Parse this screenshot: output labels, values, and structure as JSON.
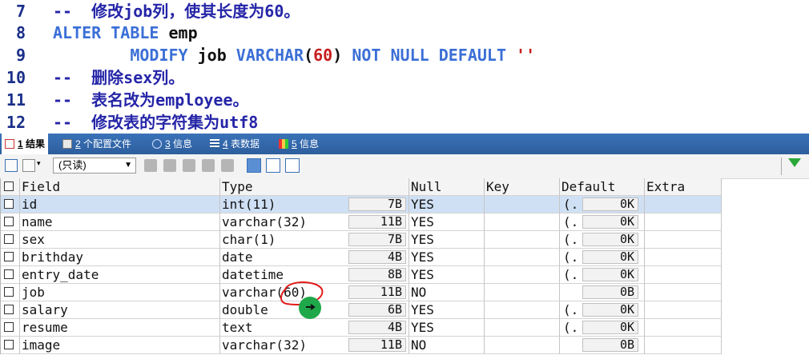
{
  "editor": {
    "lines": [
      {
        "num": "7",
        "parts": [
          {
            "cls": "cm",
            "t": "--  修改job列，使其长度为60。"
          }
        ]
      },
      {
        "num": "8",
        "parts": [
          {
            "cls": "kw",
            "t": "ALTER TABLE "
          },
          {
            "cls": "id",
            "t": "emp"
          }
        ]
      },
      {
        "num": "9",
        "parts": [
          {
            "cls": "kw",
            "t": "        MODIFY "
          },
          {
            "cls": "id",
            "t": "job "
          },
          {
            "cls": "kw",
            "t": "VARCHAR"
          },
          {
            "cls": "punc",
            "t": "("
          },
          {
            "cls": "num",
            "t": "60"
          },
          {
            "cls": "punc",
            "t": ") "
          },
          {
            "cls": "kw",
            "t": "NOT NULL DEFAULT "
          },
          {
            "cls": "str",
            "t": "''"
          }
        ]
      },
      {
        "num": "10",
        "parts": [
          {
            "cls": "cm",
            "t": "--  删除sex列。"
          }
        ]
      },
      {
        "num": "11",
        "parts": [
          {
            "cls": "cm",
            "t": "--  表名改为employee。"
          }
        ]
      },
      {
        "num": "12",
        "parts": [
          {
            "cls": "cm",
            "t": "--  修改表的字符集为utf8"
          }
        ]
      }
    ]
  },
  "tabs": [
    {
      "num": "1",
      "label": "结果"
    },
    {
      "num": "2",
      "label": "个配置文件"
    },
    {
      "num": "3",
      "label": "信息"
    },
    {
      "num": "4",
      "label": "表数据"
    },
    {
      "num": "5",
      "label": "信息"
    }
  ],
  "toolbar": {
    "mode_select": "(只读)"
  },
  "grid": {
    "headers": [
      "Field",
      "Type",
      "Null",
      "Key",
      "Default",
      "Extra"
    ],
    "rows": [
      {
        "field": "id",
        "type": "int(11)",
        "size": "7B",
        "null": "YES",
        "key": "",
        "def_ell": "(.",
        "def": "0K",
        "extra": ""
      },
      {
        "field": "name",
        "type": "varchar(32)",
        "size": "11B",
        "null": "YES",
        "key": "",
        "def_ell": "(.",
        "def": "0K",
        "extra": ""
      },
      {
        "field": "sex",
        "type": "char(1)",
        "size": "7B",
        "null": "YES",
        "key": "",
        "def_ell": "(.",
        "def": "0K",
        "extra": ""
      },
      {
        "field": "brithday",
        "type": "date",
        "size": "4B",
        "null": "YES",
        "key": "",
        "def_ell": "(.",
        "def": "0K",
        "extra": ""
      },
      {
        "field": "entry_date",
        "type": "datetime",
        "size": "8B",
        "null": "YES",
        "key": "",
        "def_ell": "(.",
        "def": "0K",
        "extra": ""
      },
      {
        "field": "job",
        "type": "varchar(60)",
        "size": "11B",
        "null": "NO",
        "key": "",
        "def_ell": "",
        "def": "0B",
        "extra": ""
      },
      {
        "field": "salary",
        "type": "double",
        "size": "6B",
        "null": "YES",
        "key": "",
        "def_ell": "(.",
        "def": "0K",
        "extra": ""
      },
      {
        "field": "resume",
        "type": "text",
        "size": "4B",
        "null": "YES",
        "key": "",
        "def_ell": "(.",
        "def": "0K",
        "extra": ""
      },
      {
        "field": "image",
        "type": "varchar(32)",
        "size": "11B",
        "null": "NO",
        "key": "",
        "def_ell": "",
        "def": "0B",
        "extra": ""
      }
    ]
  },
  "colors": {
    "tabbar": "#2d5e9e",
    "selected_row": "#cfe0f4",
    "keyword": "#3b6fd6",
    "comment": "#2525a8",
    "number": "#c81d1d",
    "annotation": "#e31b1b",
    "cursor": "#1fa84a"
  }
}
